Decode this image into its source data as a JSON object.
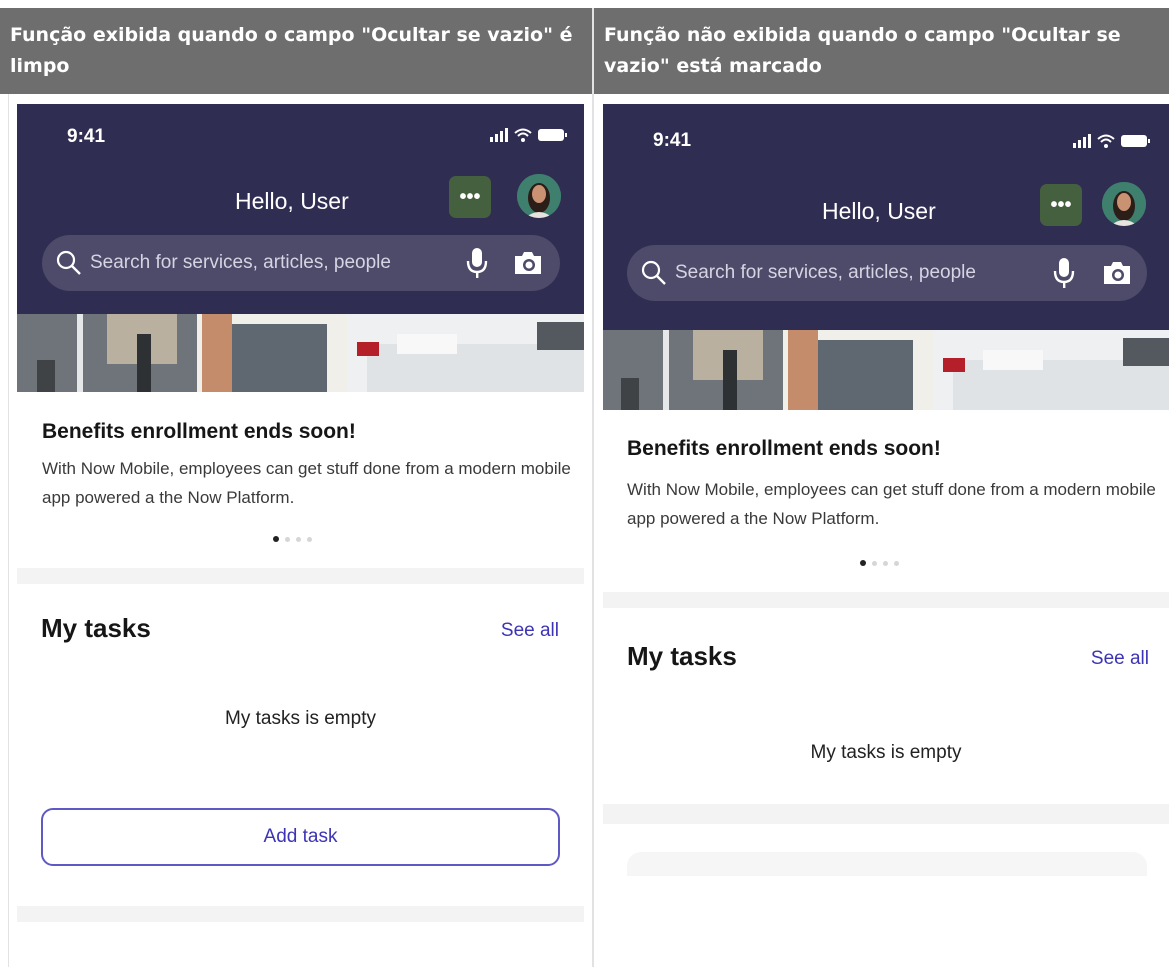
{
  "columns": [
    {
      "header": "Função exibida quando o campo \"Ocultar se vazio\" é limpo",
      "phone": {
        "time": "9:41",
        "greeting": "Hello, User",
        "search_placeholder": "Search for services, articles, people",
        "card_title": "Benefits enrollment ends soon!",
        "card_body": "With Now Mobile, employees can get stuff done from a modern mobile app powered a the Now Platform.",
        "carousel": {
          "count": 4,
          "active": 1
        },
        "tasks_title": "My tasks",
        "see_all": "See all",
        "empty_text": "My tasks is empty",
        "add_task": "Add task"
      }
    },
    {
      "header": "Função não exibida quando o campo \"Ocultar se vazio\" está marcado",
      "phone": {
        "time": "9:41",
        "greeting": "Hello, User",
        "search_placeholder": "Search for services, articles, people",
        "card_title": "Benefits enrollment ends soon!",
        "card_body": "With Now Mobile, employees can get stuff done from a modern mobile app powered a the Now Platform.",
        "carousel": {
          "count": 4,
          "active": 1
        },
        "tasks_title": "My tasks",
        "see_all": "See all",
        "empty_text": "My tasks is empty"
      }
    }
  ],
  "colors": {
    "header_bg": "#6e6e6e",
    "app_bar": "#302d53",
    "search_bg": "#4d4a6a",
    "accent": "#3c34b5",
    "more_button": "#45603f",
    "separator": "#f3f3f3"
  },
  "icons": [
    "ellipsis-icon",
    "avatar-photo",
    "search-icon",
    "microphone-icon",
    "camera-icon",
    "signal-icon",
    "wifi-icon",
    "battery-icon"
  ]
}
